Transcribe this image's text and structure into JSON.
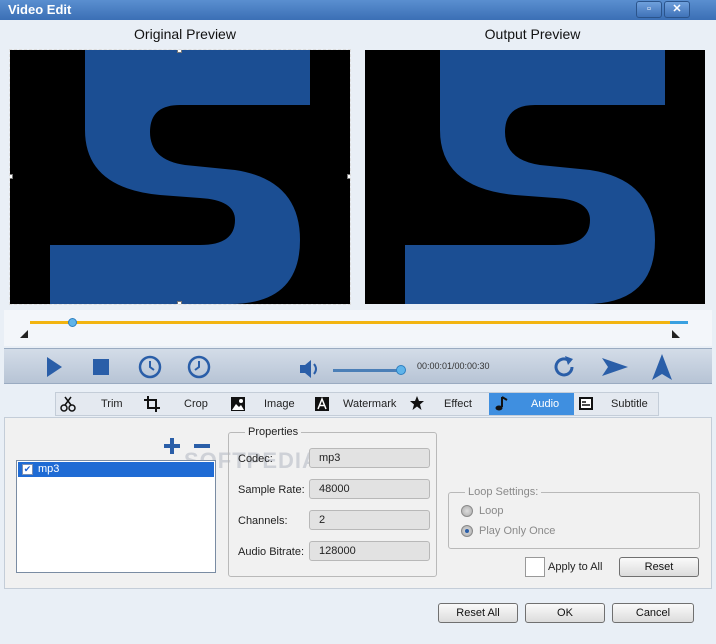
{
  "window": {
    "title": "Video Edit",
    "restore_glyph": "▫",
    "close_glyph": "✕"
  },
  "preview": {
    "original_label": "Original Preview",
    "output_label": "Output Preview"
  },
  "player": {
    "time": "00:00:01/00:00:30",
    "progress_fraction": 0.06,
    "volume_fraction": 0.92
  },
  "tabs": [
    {
      "label": "Trim",
      "icon": "scissors-icon"
    },
    {
      "label": "Crop",
      "icon": "crop-icon"
    },
    {
      "label": "Image",
      "icon": "image-icon"
    },
    {
      "label": "Watermark",
      "icon": "watermark-icon"
    },
    {
      "label": "Effect",
      "icon": "star-icon"
    },
    {
      "label": "Audio",
      "icon": "music-note-icon",
      "active": true
    },
    {
      "label": "Subtitle",
      "icon": "subtitle-icon"
    }
  ],
  "audio_tracks": [
    {
      "label": "mp3",
      "checked": true
    }
  ],
  "properties": {
    "title": "Properties",
    "rows": [
      {
        "label": "Codec:",
        "value": "mp3"
      },
      {
        "label": "Sample Rate:",
        "value": "48000"
      },
      {
        "label": "Channels:",
        "value": "2"
      },
      {
        "label": "Audio Bitrate:",
        "value": "128000"
      }
    ]
  },
  "loop_settings": {
    "title": "Loop Settings:",
    "options": [
      {
        "label": "Loop",
        "selected": false
      },
      {
        "label": "Play Only Once",
        "selected": true
      }
    ]
  },
  "apply_to_all": "Apply to All",
  "buttons": {
    "reset": "Reset",
    "reset_all": "Reset All",
    "ok": "OK",
    "cancel": "Cancel"
  },
  "colors": {
    "accent": "#3f8fe0",
    "seek": "#f2b410",
    "logo": "#1b4e93"
  },
  "watermark_text": "SOFTPEDIA"
}
